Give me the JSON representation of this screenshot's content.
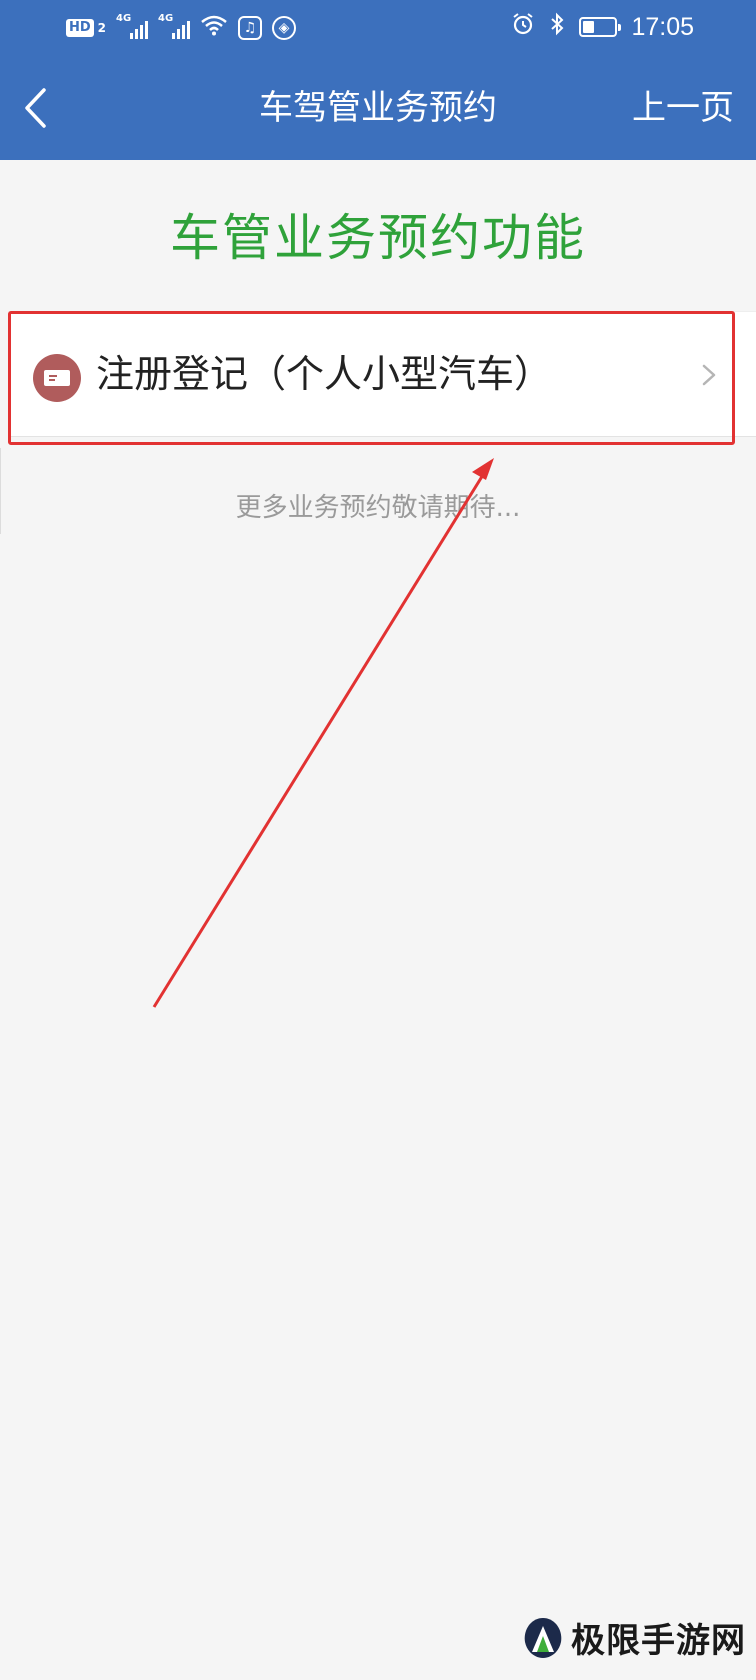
{
  "status_bar": {
    "hd_label": "HD",
    "hd_sub": "2",
    "network1": "4G",
    "network2": "4G",
    "time": "17:05",
    "battery_level": 0.35
  },
  "nav": {
    "title": "车驾管业务预约",
    "prev_label": "上一页"
  },
  "main": {
    "section_title": "车管业务预约功能",
    "items": [
      {
        "label": "注册登记（个人小型汽车）"
      }
    ],
    "more_hint": "更多业务预约敬请期待..."
  },
  "watermark": {
    "text": "极限手游网"
  },
  "colors": {
    "header_blue": "#3c70bd",
    "title_green": "#2fa23a",
    "highlight_red": "#e23232",
    "item_icon": "#b05c5c"
  }
}
